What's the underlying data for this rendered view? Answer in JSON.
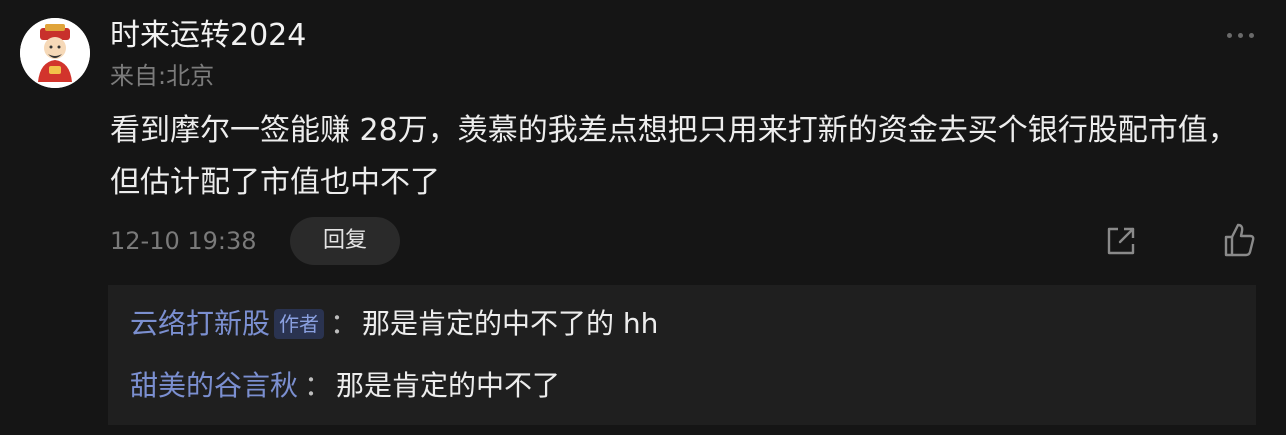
{
  "comment": {
    "username": "时来运转2024",
    "location": "来自:北京",
    "content": "看到摩尔一签能赚 28万，羡慕的我差点想把只用来打新的资金去买个银行股配市值，但估计配了市值也中不了",
    "timestamp": "12-10 19:38",
    "reply_label": "回复"
  },
  "icons": {
    "avatar": "god-of-wealth-avatar",
    "more": "more-dots-icon",
    "share": "share-icon",
    "like": "thumbs-up-icon"
  },
  "replies": [
    {
      "author": "云络打新股",
      "badge": "作者",
      "colon": "：",
      "text": "那是肯定的中不了的 hh"
    },
    {
      "author": "甜美的谷言秋",
      "badge": "",
      "colon": "：",
      "text": "那是肯定的中不了"
    }
  ],
  "colors": {
    "background": "#151515",
    "reply_panel": "#1f1f1f",
    "author_link": "#7b8fd0",
    "muted_text": "#7a7a7a"
  }
}
